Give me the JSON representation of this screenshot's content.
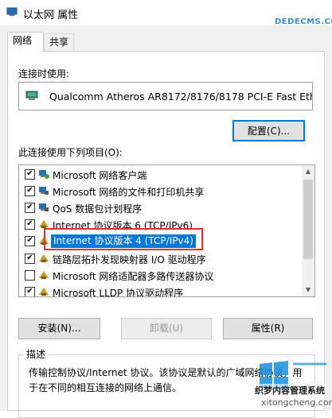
{
  "window": {
    "title": "以太网 属性",
    "icon": "network-adapter-icon"
  },
  "tabs": [
    {
      "label": "网络",
      "selected": true
    },
    {
      "label": "共享",
      "selected": false
    }
  ],
  "connection": {
    "label": "连接时使用:",
    "adapter_name": "Qualcomm Atheros AR8172/8176/8178 PCI-E Fast Ethe",
    "configure_button": "配置(C)..."
  },
  "items": {
    "label": "此连接使用下列项目(O):",
    "list": [
      {
        "checked": true,
        "label": "Microsoft 网络客户端",
        "icon": "network-client-icon"
      },
      {
        "checked": true,
        "label": "Microsoft 网络的文件和打印机共享",
        "icon": "file-printer-share-icon"
      },
      {
        "checked": true,
        "label": "QoS 数据包计划程序",
        "icon": "qos-scheduler-icon"
      },
      {
        "checked": true,
        "label": "Internet 协议版本 6 (TCP/IPv6)",
        "icon": "protocol-icon"
      },
      {
        "checked": true,
        "label": "Internet 协议版本 4 (TCP/IPv4)",
        "icon": "protocol-icon",
        "selected": true
      },
      {
        "checked": true,
        "label": "链路层拓扑发现映射器 I/O 驱动程序",
        "icon": "protocol-icon"
      },
      {
        "checked": false,
        "label": "Microsoft 网络适配器多路传送器协议",
        "icon": "protocol-icon"
      },
      {
        "checked": true,
        "label": "Microsoft LLDP 协议驱动程序",
        "icon": "protocol-icon"
      }
    ]
  },
  "buttons": {
    "install": "安装(N)...",
    "uninstall": "卸载(U)",
    "properties": "属性(R)"
  },
  "description": {
    "legend": "描述",
    "text": "传输控制协议/Internet 协议。该协议是默认的广域网络协议，用于在不同的相互连接的网络上通信。"
  },
  "watermark": {
    "url": "DEDECMS.COM",
    "text": "织梦内容管理系统",
    "domain": "xitongcheng.com"
  },
  "colors": {
    "selection": "#0078d7",
    "highlight_box": "#e03030",
    "focus_border": "#0078d7"
  }
}
